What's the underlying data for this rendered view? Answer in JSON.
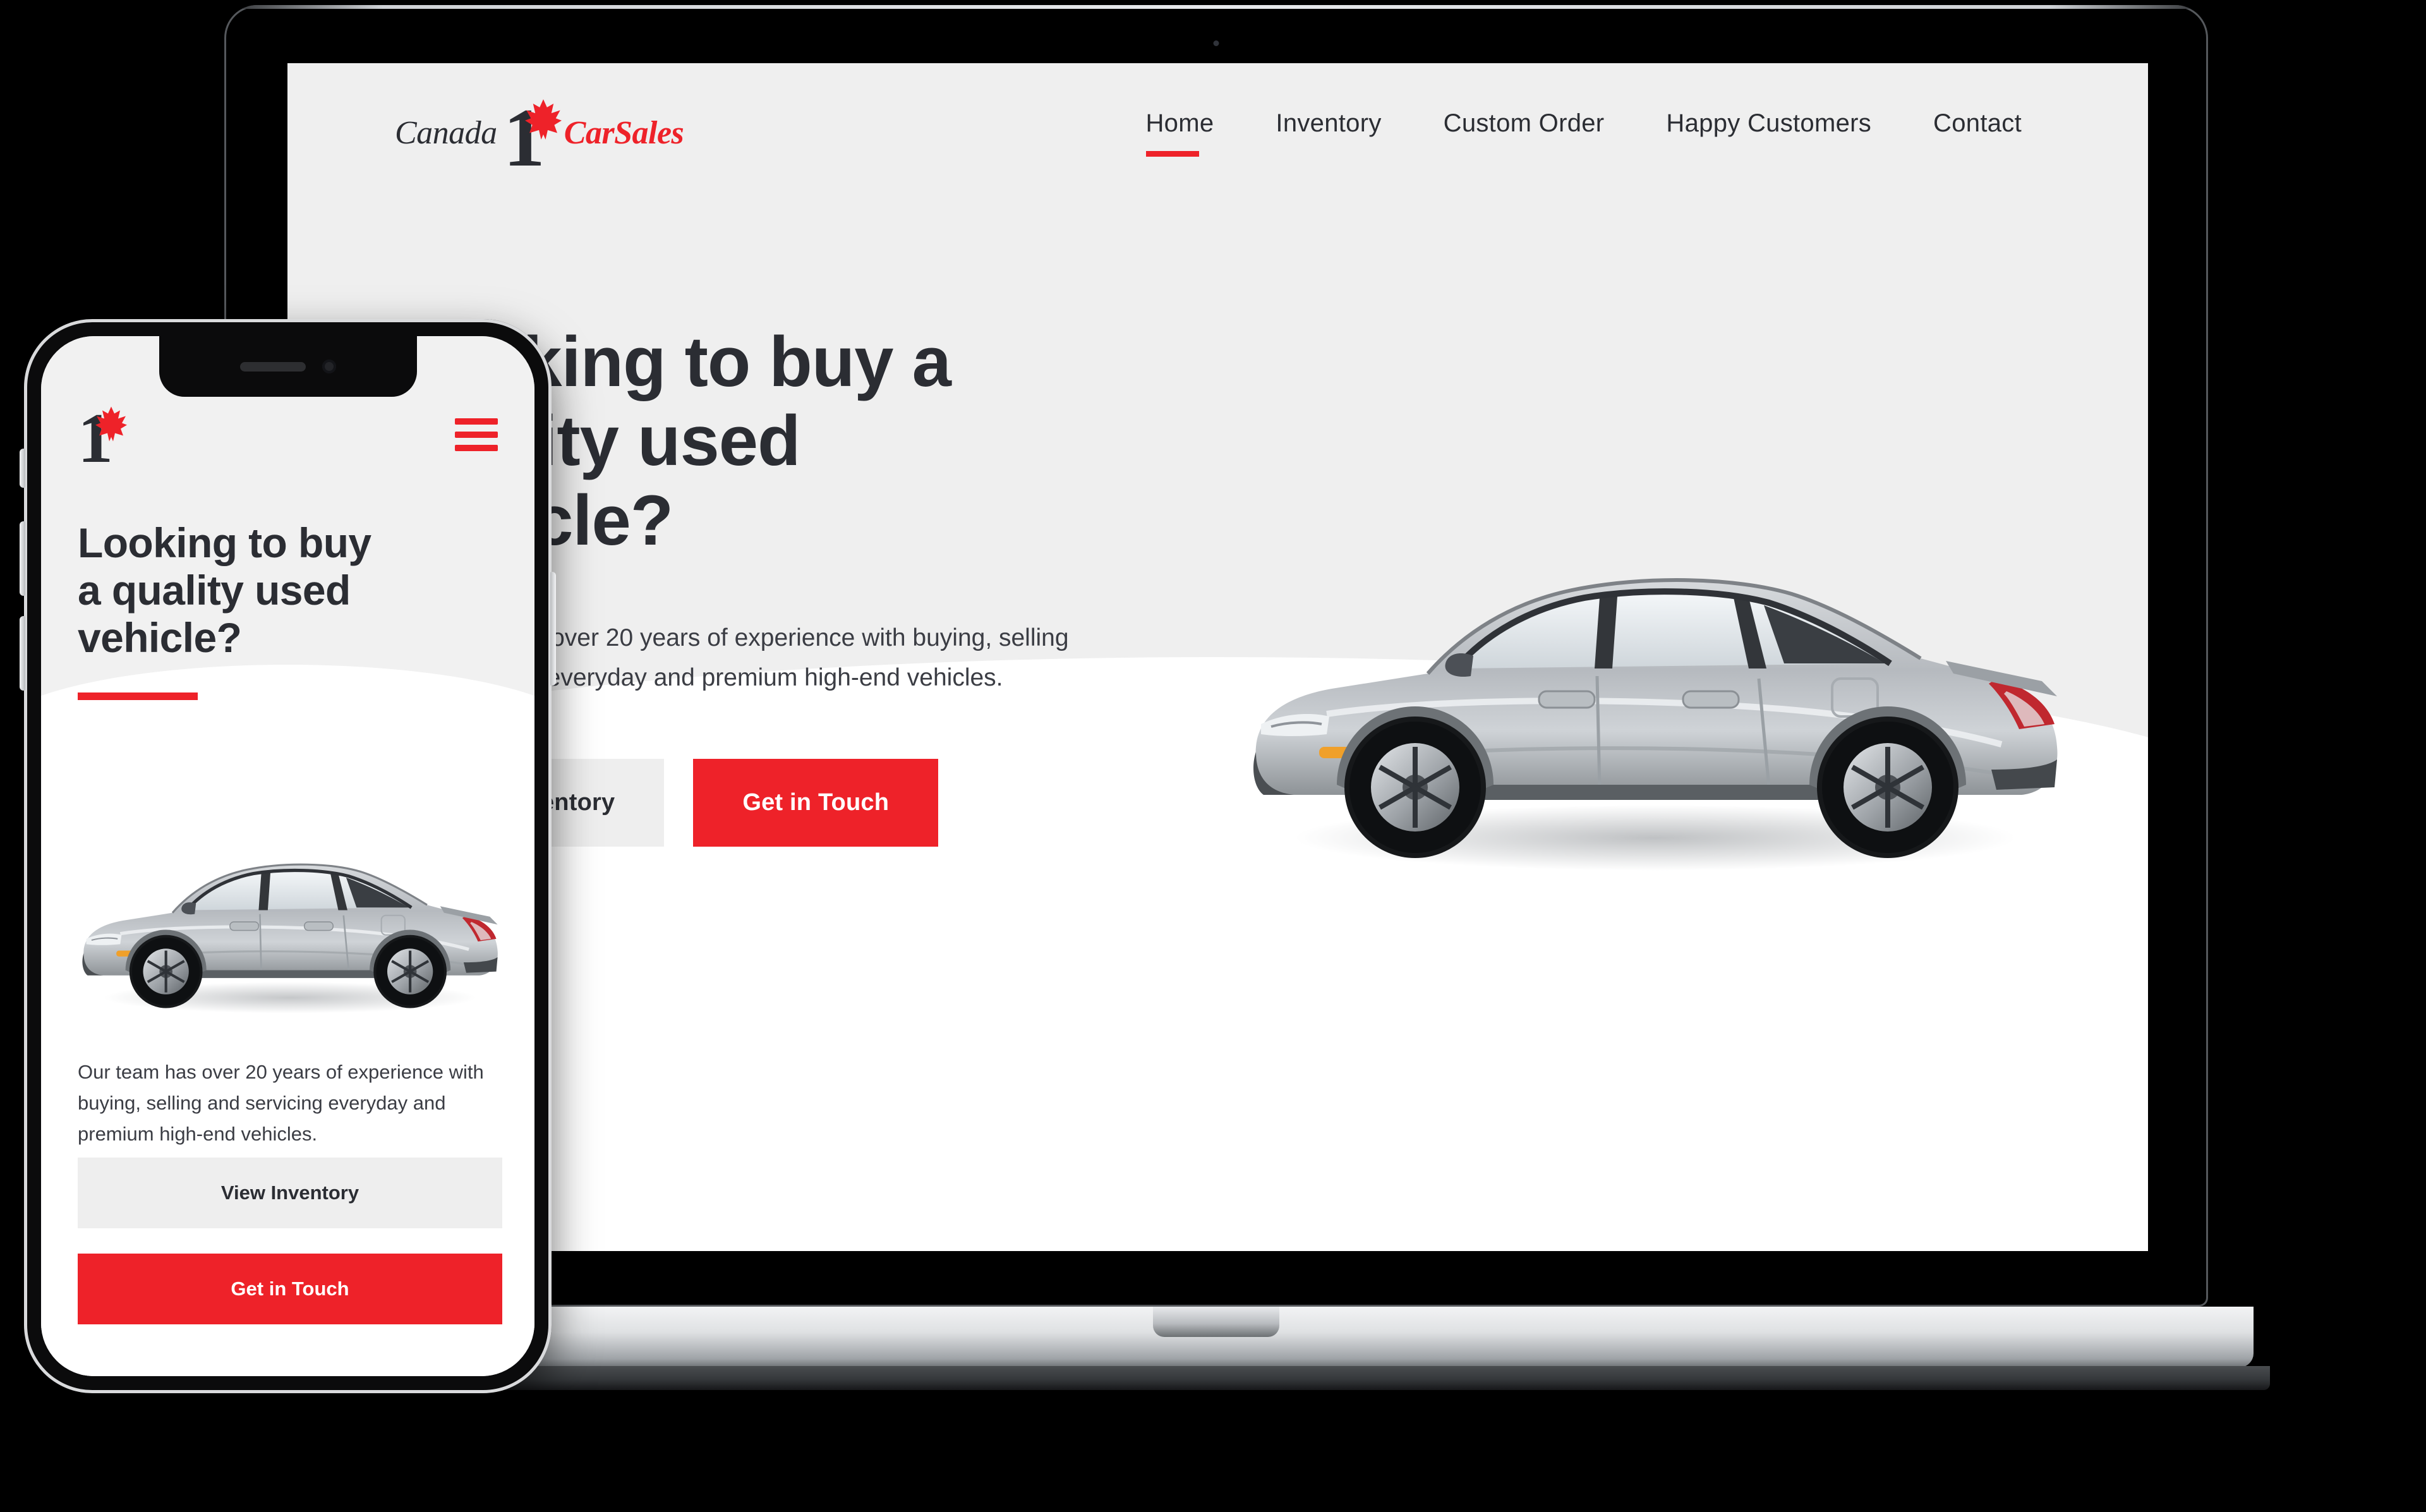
{
  "brand": {
    "name_part_dark": "Canada",
    "name_part_red": "CarSales",
    "numeral": "1",
    "accent_color": "#ee2229",
    "text_color": "#2b2d33",
    "page_bg": "#efefef",
    "lower_bg": "#ffffff"
  },
  "desktop": {
    "nav": [
      {
        "label": "Home",
        "active": true
      },
      {
        "label": "Inventory",
        "active": false
      },
      {
        "label": "Custom Order",
        "active": false
      },
      {
        "label": "Happy Customers",
        "active": false
      },
      {
        "label": "Contact",
        "active": false
      }
    ],
    "hero": {
      "heading_line1": "Looking to buy a",
      "heading_line2": "quality used",
      "heading_line3": "vehicle?",
      "body": "Our team has over 20 years of experience with buying, selling and servicing everyday and premium high-end vehicles.",
      "primary_button": "Get in Touch",
      "secondary_button": "View Inventory"
    },
    "car_alt": "silver-hatchback-side-view"
  },
  "mobile": {
    "menu_icon": "hamburger-menu-icon",
    "hero": {
      "heading_line1": "Looking to buy",
      "heading_line2": "a quality used",
      "heading_line3": "vehicle?",
      "body": "Our team has over 20 years of experience with buying, selling and servicing everyday and premium high-end vehicles.",
      "primary_button": "Get in Touch",
      "secondary_button": "View Inventory"
    },
    "car_alt": "silver-hatchback-side-view"
  }
}
